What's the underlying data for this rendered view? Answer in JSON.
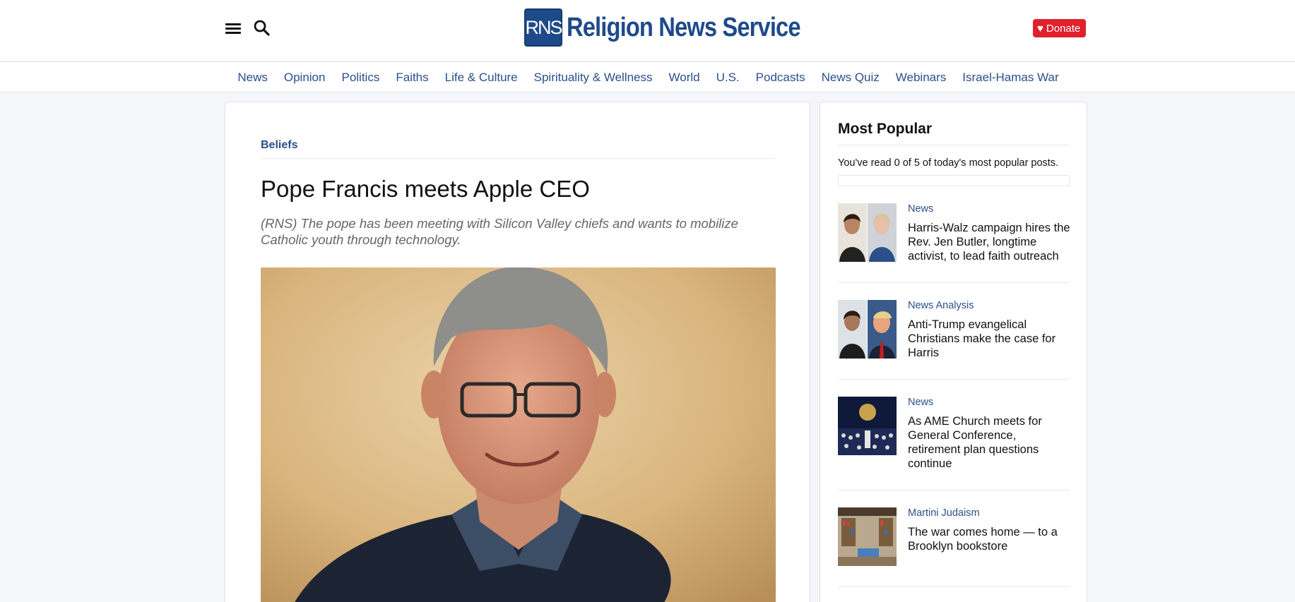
{
  "header": {
    "logo_mark": "RNS",
    "logo_text": "Religion News Service",
    "donate_label": "Donate"
  },
  "nav": {
    "items": [
      "News",
      "Opinion",
      "Politics",
      "Faiths",
      "Life & Culture",
      "Spirituality & Wellness",
      "World",
      "U.S.",
      "Podcasts",
      "News Quiz",
      "Webinars",
      "Israel-Hamas War"
    ]
  },
  "article": {
    "kicker": "Beliefs",
    "headline": "Pope Francis meets Apple CEO",
    "dek": "(RNS) The pope has been meeting with Silicon Valley chiefs and wants to mobilize Catholic youth through technology."
  },
  "sidebar": {
    "title": "Most Popular",
    "read_note": "You've read 0 of 5 of today's most popular posts.",
    "read_progress": 0,
    "items": [
      {
        "category": "News",
        "title": "Harris-Walz campaign hires the Rev. Jen Butler, longtime activist, to lead faith outreach"
      },
      {
        "category": "News Analysis",
        "title": "Anti-Trump evangelical Christians make the case for Harris"
      },
      {
        "category": "News",
        "title": "As AME Church meets for General Conference, retirement plan questions continue"
      },
      {
        "category": "Martini Judaism",
        "title": "The war comes home — to a Brooklyn bookstore"
      }
    ]
  },
  "colors": {
    "brand_blue": "#1e4a8a",
    "link_blue": "#2b4f8a",
    "donate_red": "#e0212c"
  }
}
